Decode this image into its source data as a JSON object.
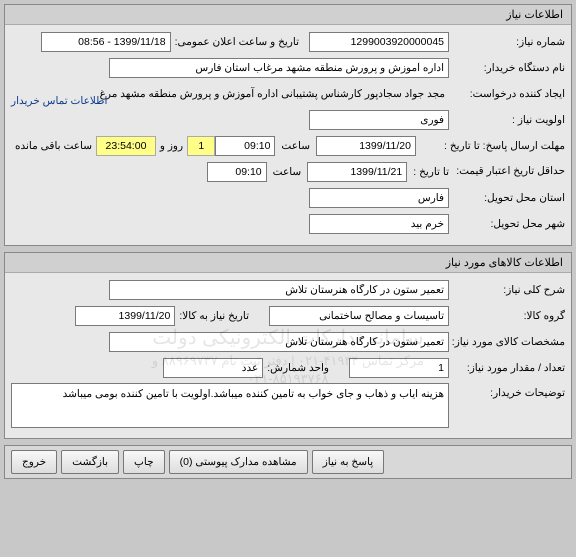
{
  "panel1": {
    "title": "اطلاعات نیاز",
    "need_no_label": "شماره نیاز:",
    "need_no": "1299003920000045",
    "announce_label": "تاریخ و ساعت اعلان عمومی:",
    "announce_value": "1399/11/18 - 08:56",
    "buyer_label": "نام دستگاه خریدار:",
    "buyer_value": "اداره آموزش و پرورش منطقه مشهد مرغاب استان فارس",
    "requester_label": "ایجاد کننده درخواست:",
    "requester_value": "مجد جواد  سجادپور کارشناس پشتیبانی اداره آموزش و پرورش منطقه مشهد مرغ",
    "priority_label": "اولویت نیاز :",
    "priority_value": "فوری",
    "deadline_label": "مهلت ارسال پاسخ:  تا تاریخ :",
    "deadline_date": "1399/11/20",
    "time_label": "ساعت",
    "deadline_time": "09:10",
    "days_value": "1",
    "days_label": "روز و",
    "remain_value": "23:54:00",
    "remain_label": "ساعت باقی مانده",
    "validity_label": "حداقل تاریخ اعتبار قیمت:",
    "validity_sub": "تا تاریخ :",
    "validity_date": "1399/11/21",
    "validity_time": "09:10",
    "province_label": "استان محل تحویل:",
    "province_value": "فارس",
    "city_label": "شهر محل تحویل:",
    "city_value": "خرم بید",
    "contact_link": "اطلاعات تماس خریدار"
  },
  "panel2": {
    "title": "اطلاعات کالاهای مورد نیاز",
    "summary_label": "شرح کلی نیاز:",
    "summary_value": "تعمیر ستون در کارگاه هنرستان تلاش",
    "group_label": "گروه کالا:",
    "group_value": "تاسیسات و مصالح ساختمانی",
    "need_date_label": "تاریخ نیاز به کالا:",
    "need_date_value": "1399/11/20",
    "spec_label": "مشخصات کالای مورد نیاز:",
    "spec_value": "تعمیر ستون در کارگاه هنرستان تلاش",
    "qty_label": "تعداد / مقدار مورد نیاز:",
    "qty_value": "1",
    "unit_label": "واحد شمارش:",
    "unit_value": "عدد",
    "desc_label": "توضیحات خریدار:",
    "desc_value": "هزینه ایاب و ذهاب و جای خواب به تامین کننده میباشد.اولویت با تامین کننده بومی میباشد",
    "watermark_line1": "سامانه تدارکات الکترونیکی دولت",
    "watermark_line2": "مرکز تماس ۴۱۹۳۴-۰۲۱  |  دفتر ثبت نام ۸۸۹۶۹۷۳۷ و ۸۵۱۹۳۷۶۸-۰۲۱"
  },
  "buttons": {
    "respond": "پاسخ به نیاز",
    "attachments": "مشاهده مدارک پیوستی (0)",
    "print": "چاپ",
    "back": "بازگشت",
    "exit": "خروج"
  }
}
